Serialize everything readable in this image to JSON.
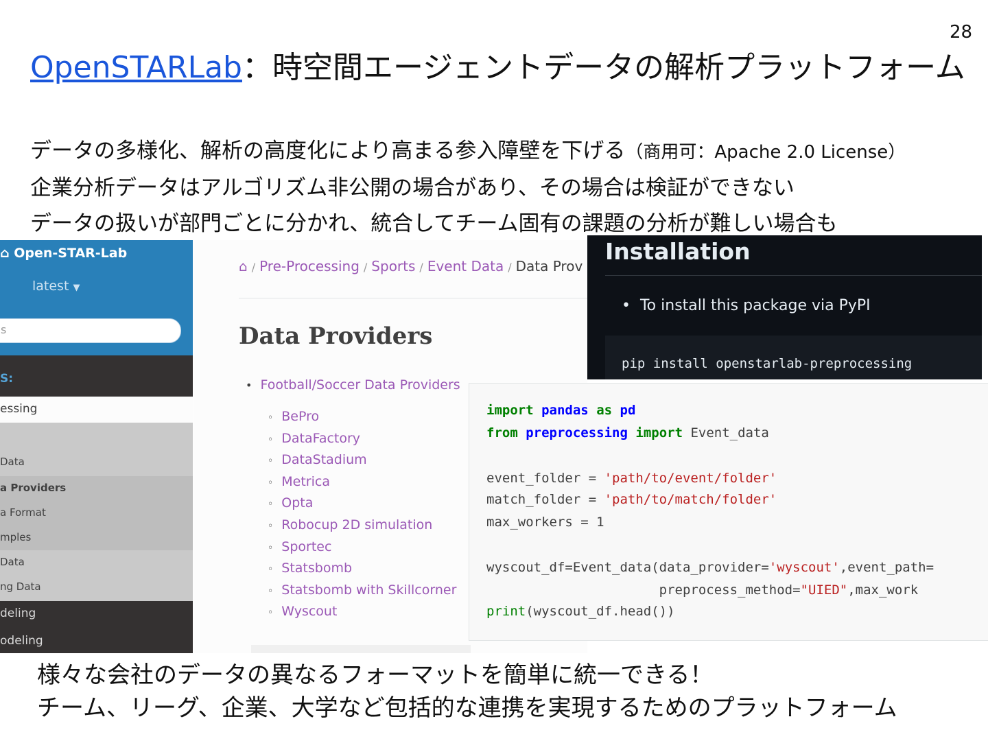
{
  "slide": {
    "page_number": "28",
    "title_link": "OpenSTARLab",
    "title_rest": "：時空間エージェントデータの解析プラットフォーム",
    "bullets": [
      "データの多様化、解析の高度化により高まる参入障壁を下げる",
      "（商用可：Apache 2.0 License）",
      "企業分析データはアルゴリズム非公開の場合があり、その場合は検証ができない",
      "データの扱いが部門ごとに分かれ、統合してチーム固有の課題の分析が難しい場合も"
    ],
    "bottom_lines": [
      "様々な会社のデータの異なるフォーマットを簡単に統一できる！",
      "チーム、リーグ、企業、大学など包括的な連携を実現するためのプラットフォーム"
    ]
  },
  "docs": {
    "brand": "Open-STAR-Lab",
    "version": "latest",
    "search_placeholder": "s",
    "caption": "S:",
    "current": "essing",
    "sub_items": [
      "Data",
      "a Providers",
      "a Format",
      "mples",
      "Data",
      "ng Data"
    ],
    "dark_items": [
      "deling",
      "odeling"
    ],
    "breadcrumbs": [
      "Pre-Processing",
      "Sports",
      "Event Data",
      "Data Prov"
    ],
    "heading": "Data Providers",
    "toc_top": "Football/Soccer Data Providers",
    "providers": [
      "BePro",
      "DataFactory",
      "DataStadium",
      "Metrica",
      "Opta",
      "Robocup 2D simulation",
      "Sportec",
      "Statsbomb",
      "Statsbomb with Skillcorner",
      "Wyscout"
    ]
  },
  "install": {
    "heading": "Installation",
    "item": "To install this package via PyPI",
    "command": "pip install openstarlab-preprocessing"
  },
  "code": {
    "l1_kw1": "import",
    "l1_mod": "pandas",
    "l1_kw2": "as",
    "l1_alias": "pd",
    "l2_kw1": "from",
    "l2_mod": "preprocessing",
    "l2_kw2": "import",
    "l2_name": "Event_data",
    "l3_var": "event_folder = ",
    "l3_str": "'path/to/event/folder'",
    "l4_var": "match_folder = ",
    "l4_str": "'path/to/match/folder'",
    "l5": "max_workers = 1",
    "l6_a": "wyscout_df=Event_data(data_provider=",
    "l6_str": "'wyscout'",
    "l6_b": ",event_path=",
    "l7_a": "                      preprocess_method=",
    "l7_str": "\"UIED\"",
    "l7_b": ",max_work",
    "l8_fn": "print",
    "l8_rest": "(wyscout_df.head())"
  }
}
